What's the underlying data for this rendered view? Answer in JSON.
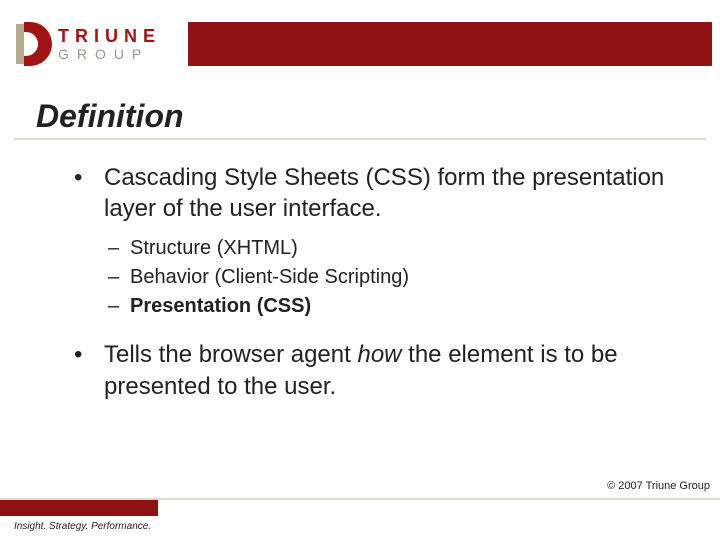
{
  "logo": {
    "line1": "TRIUNE",
    "line2": "GROUP"
  },
  "title": "Definition",
  "bullets": [
    {
      "text": "Cascading Style Sheets (CSS) form the presentation layer of the user interface.",
      "sub": [
        {
          "text": "Structure (XHTML)",
          "bold": false
        },
        {
          "text": "Behavior (Client-Side Scripting)",
          "bold": false
        },
        {
          "text": "Presentation (CSS)",
          "bold": true
        }
      ]
    },
    {
      "text_parts": [
        {
          "t": "Tells the browser agent ",
          "italic": false
        },
        {
          "t": "how",
          "italic": true
        },
        {
          "t": " the element is to be presented to the user.",
          "italic": false
        }
      ]
    }
  ],
  "copyright": "© 2007 Triune Group",
  "tagline": "Insight. Strategy. Performance."
}
